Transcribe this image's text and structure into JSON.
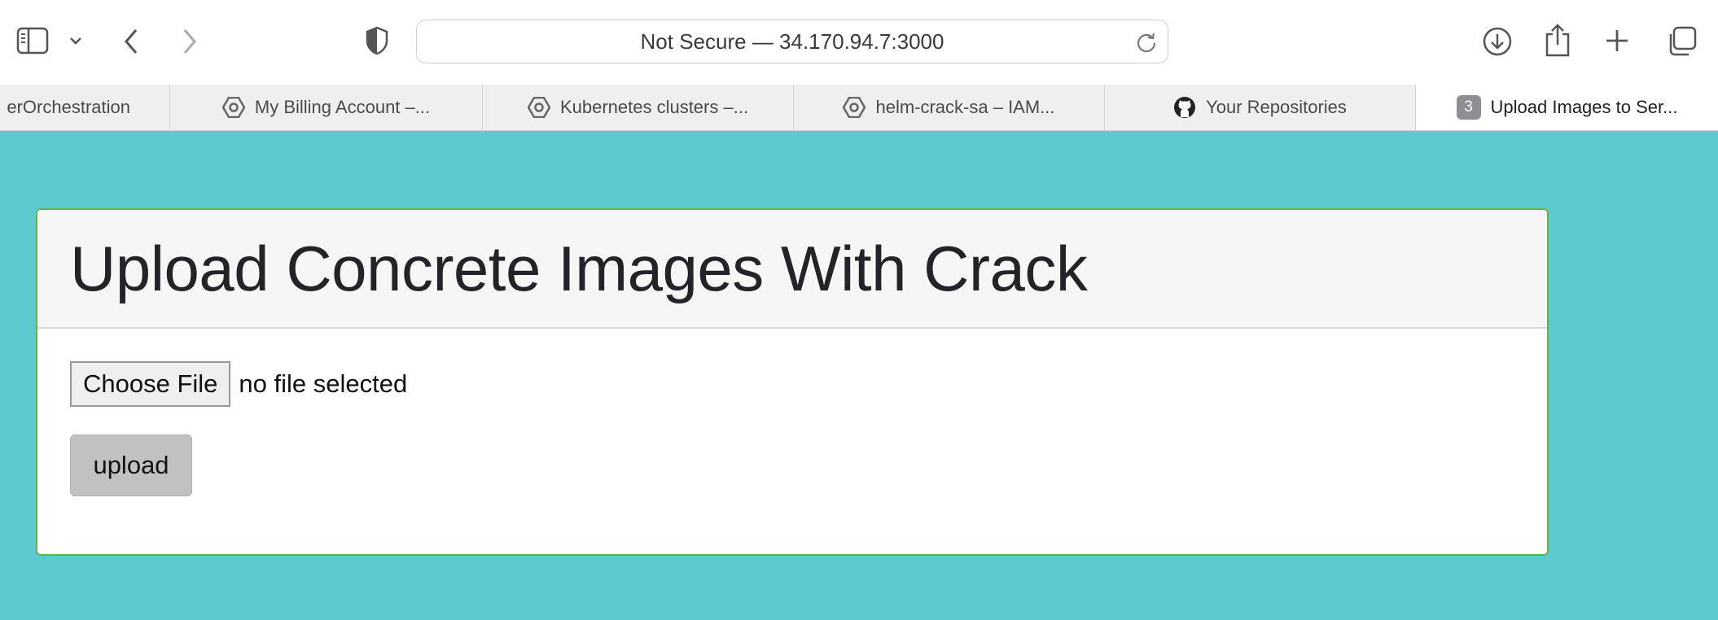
{
  "browser": {
    "address": "Not Secure — 34.170.94.7:3000",
    "icons": {
      "sidebar": "sidebar-icon",
      "back": "chevron-left-icon",
      "forward": "chevron-right-icon",
      "shield": "shield-icon",
      "reload": "reload-icon",
      "download": "download-icon",
      "share": "share-icon",
      "new_tab": "plus-icon",
      "tab_overview": "tabs-icon"
    },
    "tabs": [
      {
        "label": "erOrchestration",
        "icon": ""
      },
      {
        "label": "My Billing Account –...",
        "icon": "gcp-icon"
      },
      {
        "label": "Kubernetes clusters –...",
        "icon": "gcp-icon"
      },
      {
        "label": "helm-crack-sa – IAM...",
        "icon": "gcp-icon"
      },
      {
        "label": "Your Repositories",
        "icon": "github-icon"
      },
      {
        "label": "Upload Images to Ser...",
        "badge": "3",
        "active": true
      }
    ]
  },
  "page": {
    "title": "Upload Concrete Images With Crack",
    "choose_file_label": "Choose File",
    "file_status": "no file selected",
    "upload_label": "upload"
  },
  "colors": {
    "page_background": "#5ccbcf",
    "card_border": "#6ab04c",
    "header_background": "#f6f6f6",
    "upload_button": "#c1c1c1"
  }
}
